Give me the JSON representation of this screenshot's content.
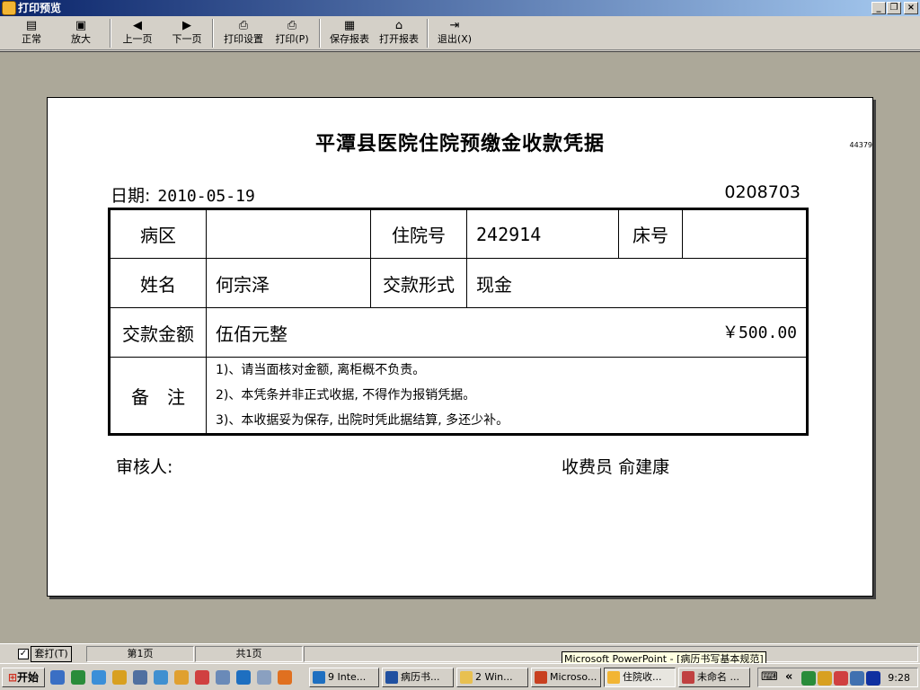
{
  "window": {
    "title": "打印预览"
  },
  "toolbar": {
    "normal": "正常",
    "zoom": "放大",
    "prev_page": "上一页",
    "next_page": "下一页",
    "print_setup": "打印设置",
    "print": "打印(P)",
    "save_report": "保存报表",
    "open_report": "打开报表",
    "exit": "退出(X)"
  },
  "document": {
    "title": "平潭县医院住院预缴金收款凭据",
    "side_code": "44379",
    "date_label": "日期:",
    "date_value": "2010-05-19",
    "serial": "0208703",
    "ward_label": "病区",
    "ward_value": "",
    "admission_label": "住院号",
    "admission_value": "242914",
    "bed_label": "床号",
    "bed_value": "",
    "name_label": "姓名",
    "name_value": "何宗泽",
    "payment_form_label": "交款形式",
    "payment_form_value": "现金",
    "amount_label": "交款金额",
    "amount_words": "伍佰元整",
    "amount_number": "￥500.00",
    "notes_label": "备　注",
    "notes": [
      "1)、请当面核对金额, 离柜概不负责。",
      "2)、本凭条并非正式收据, 不得作为报销凭据。",
      "3)、本收据妥为保存, 出院时凭此据结算, 多还少补。"
    ],
    "auditor_label": "审核人:",
    "cashier_label": "收费员",
    "cashier_name": "俞建康"
  },
  "statusbar": {
    "checkbox_label": "套打(T)",
    "page_current": "第1页",
    "page_total": "共1页",
    "tooltip": "Microsoft PowerPoint - [病历书写基本规范]"
  },
  "taskbar": {
    "start": "开始",
    "tasks": [
      "9 Inte...",
      "病历书...",
      "2 Win...",
      "Microso...",
      "住院收...",
      "未命名 ..."
    ],
    "clock": "9:28"
  }
}
